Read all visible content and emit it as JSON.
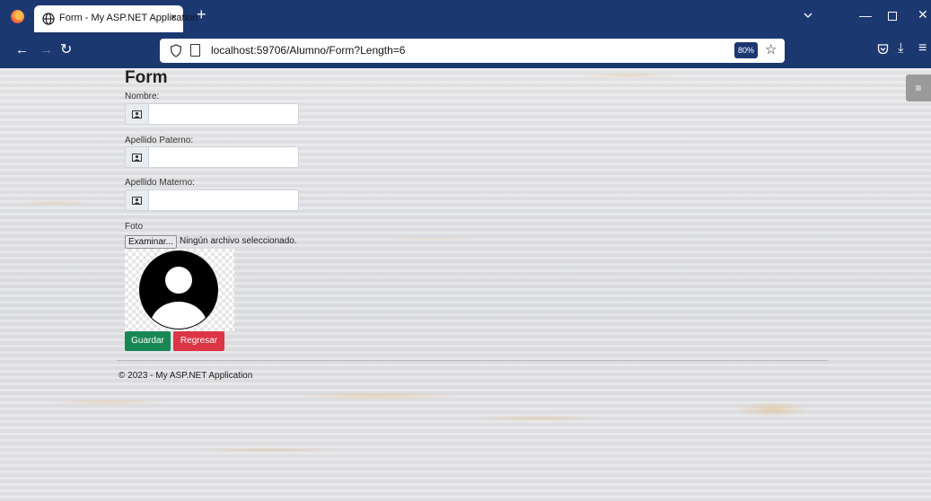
{
  "browser": {
    "tab_title": "Form - My ASP.NET Application",
    "tab_close": "×",
    "new_tab": "+",
    "url": "localhost:59706/Alumno/Form?Length=6",
    "zoom": "80%"
  },
  "page": {
    "title": "Form",
    "fields": [
      {
        "label": "Nombre:",
        "value": ""
      },
      {
        "label": "Apellido Paterno:",
        "value": ""
      },
      {
        "label": "Apellido Materno:",
        "value": ""
      }
    ],
    "photo_label": "Foto",
    "file_button": "Examinar...",
    "file_status": "Ningún archivo seleccionado.",
    "save_button": "Guardar",
    "back_button": "Regresar",
    "footer": "© 2023 - My ASP.NET Application"
  },
  "colors": {
    "chrome": "#1c3871",
    "save": "#198754",
    "back": "#dc3545"
  }
}
